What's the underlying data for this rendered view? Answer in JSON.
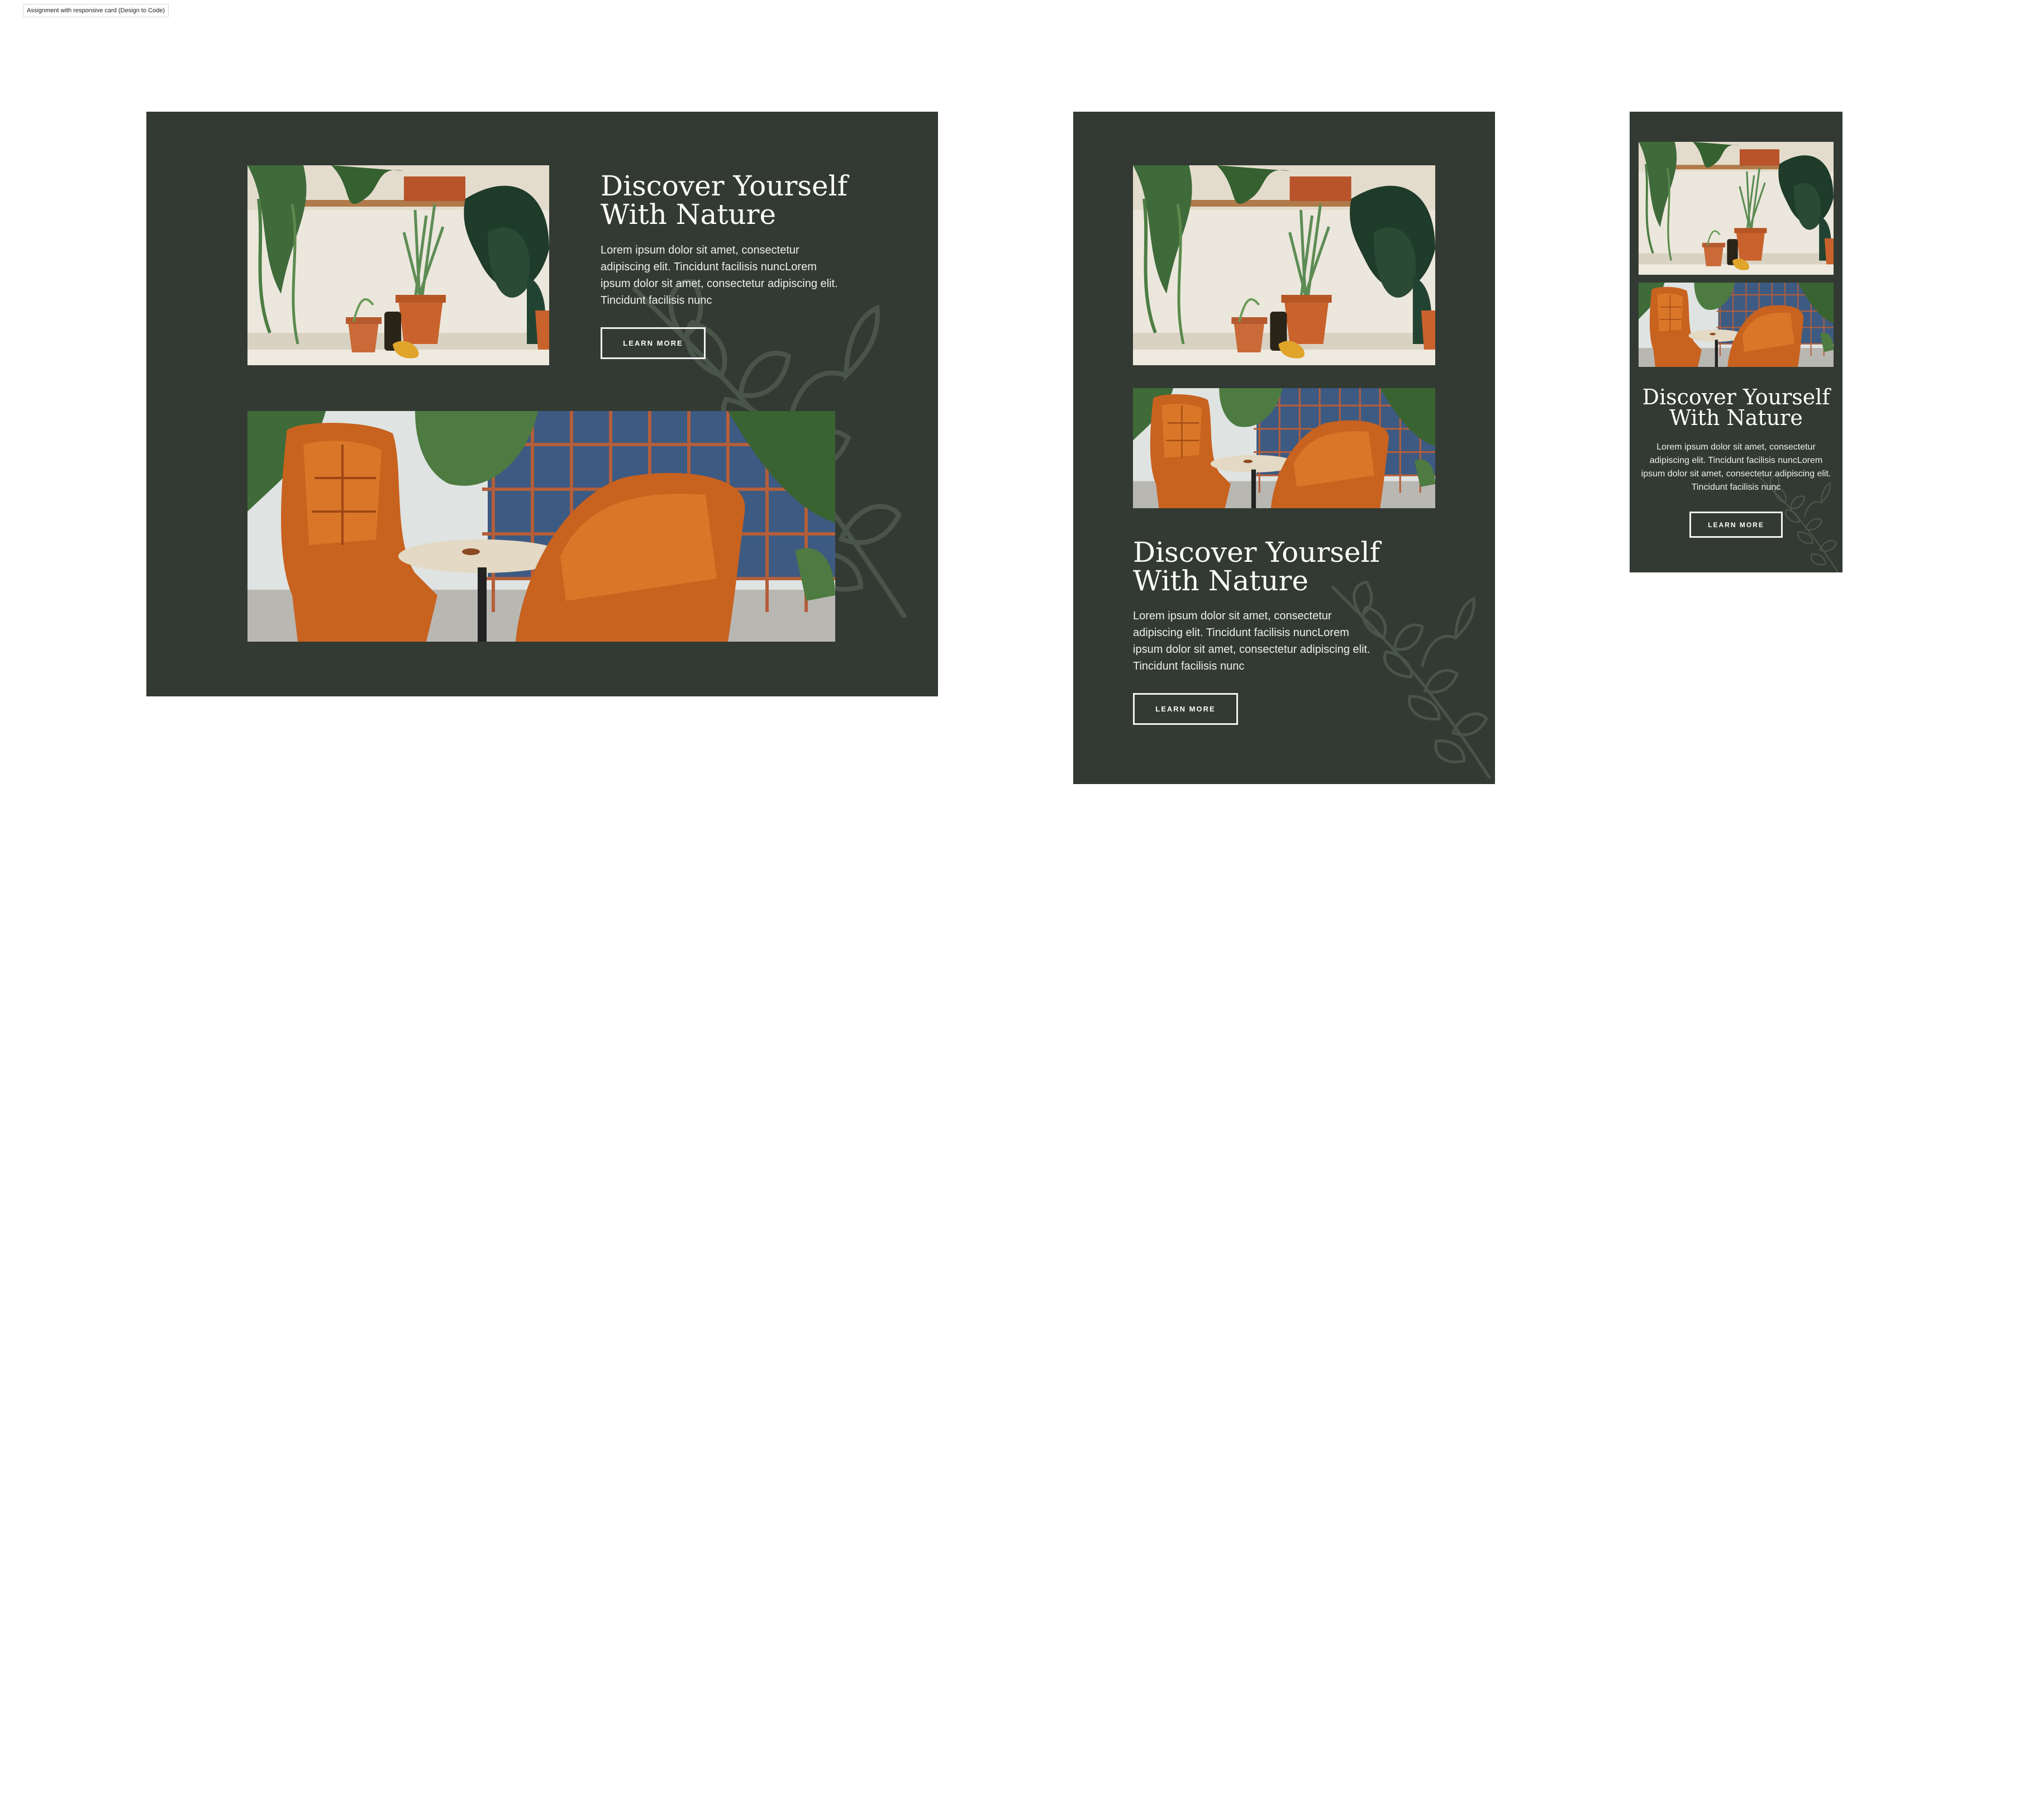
{
  "frame": {
    "label": "Assignment with responsive card (Design to Code)"
  },
  "colors": {
    "card_background": "#333a33",
    "leaf_motif": "#4a554a",
    "heading_text": "#ffffff",
    "button_border": "#f2f2f2",
    "accent_orange": "#c8621f"
  },
  "card": {
    "heading": "Discover Yourself\nWith Nature",
    "body_desktop_tablet": "Lorem ipsum dolor sit amet, consectetur adipiscing elit. Tincidunt facilisis nuncLorem ipsum dolor sit amet, consectetur adipiscing elit. Tincidunt facilisis nunc",
    "body_mobile": "Lorem ipsum dolor sit amet, consectetur adipiscing elit. Tincidunt facilisis nuncLorem ipsum dolor sit amet, consectetur adipiscing elit. Tincidunt facilisis nunc",
    "button_label": "LEARN MORE"
  },
  "variants": [
    {
      "name": "desktop"
    },
    {
      "name": "tablet"
    },
    {
      "name": "mobile"
    }
  ],
  "icons": {
    "leaf": "leaf-branch-icon"
  }
}
